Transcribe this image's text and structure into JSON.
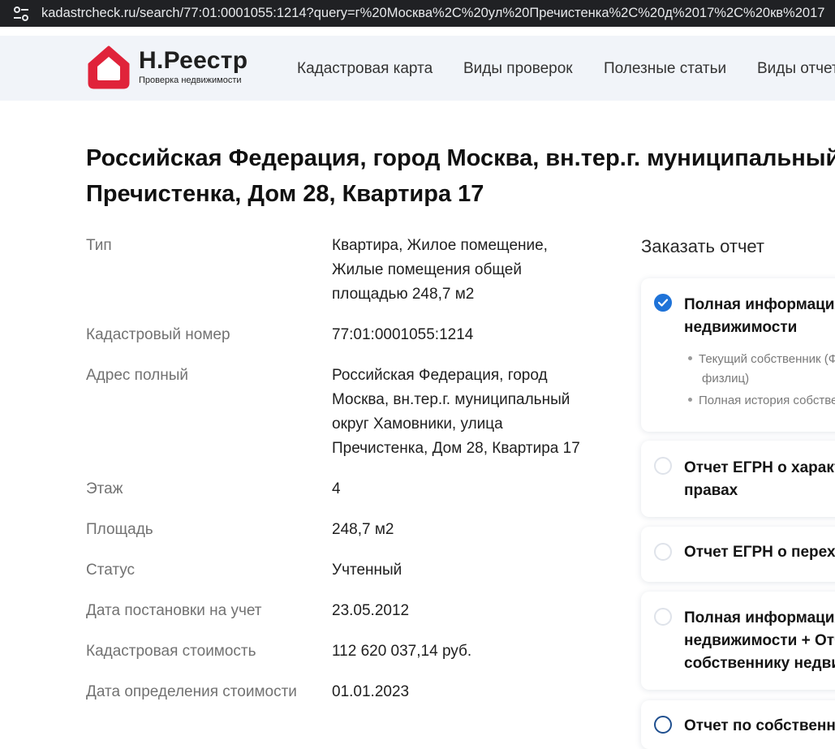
{
  "browser": {
    "url": "kadastrcheck.ru/search/77:01:0001055:1214?query=г%20Москва%2C%20ул%20Пречистенка%2C%20д%2017%2C%20кв%2017"
  },
  "header": {
    "brand_name": "Н.Реестр",
    "brand_tagline": "Проверка недвижимости",
    "logo_color": "#e0233a",
    "nav": [
      "Кадастровая карта",
      "Виды проверок",
      "Полезные статьи",
      "Виды отчетов"
    ]
  },
  "page": {
    "title_line1": "Российская Федерация, город Москва, вн.тер.г. муниципальный",
    "title_line2": "Пречистенка, Дом 28, Квартира 17"
  },
  "details": [
    {
      "label": "Тип",
      "lines": [
        "Квартира, Жилое помещение,",
        "Жилые помещения общей",
        "площадью 248,7 м2"
      ]
    },
    {
      "label": "Кадастровый номер",
      "lines": [
        "77:01:0001055:1214"
      ]
    },
    {
      "label": "Адрес полный",
      "lines": [
        "Российская Федерация, город",
        "Москва, вн.тер.г. муниципальный",
        "округ Хамовники, улица",
        "Пречистенка, Дом 28, Квартира 17"
      ]
    },
    {
      "label": "Этаж",
      "lines": [
        "4"
      ]
    },
    {
      "label": "Площадь",
      "lines": [
        "248,7 м2"
      ]
    },
    {
      "label": "Статус",
      "lines": [
        "Учтенный"
      ]
    },
    {
      "label": "Дата постановки на учет",
      "lines": [
        "23.05.2012"
      ]
    },
    {
      "label": "Кадастровая стоимость",
      "lines": [
        "112 620 037,14 руб."
      ]
    },
    {
      "label": "Дата определения стоимости",
      "lines": [
        "01.01.2023"
      ]
    }
  ],
  "order": {
    "heading": "Заказать отчет",
    "accent_color": "#1f73d8",
    "options": [
      {
        "selected": true,
        "title_lines": [
          "Полная информация об объекте",
          "недвижимости"
        ],
        "bullets": [
          [
            "Текущий собственник (ФИО",
            "физлиц)"
          ],
          [
            "Полная история собственников"
          ]
        ]
      },
      {
        "selected": false,
        "title_lines": [
          "Отчет ЕГРН о характеристиках и",
          "правах"
        ],
        "bullets": []
      },
      {
        "selected": false,
        "title_lines": [
          "Отчет ЕГРН о переходе прав"
        ],
        "bullets": []
      },
      {
        "selected": false,
        "title_lines": [
          "Полная информация об объекте",
          "недвижимости + Отчет",
          "собственнику недвижимости"
        ],
        "bullets": []
      },
      {
        "selected": false,
        "title_lines": [
          "Отчет по собственнику"
        ],
        "bullets": []
      }
    ]
  }
}
